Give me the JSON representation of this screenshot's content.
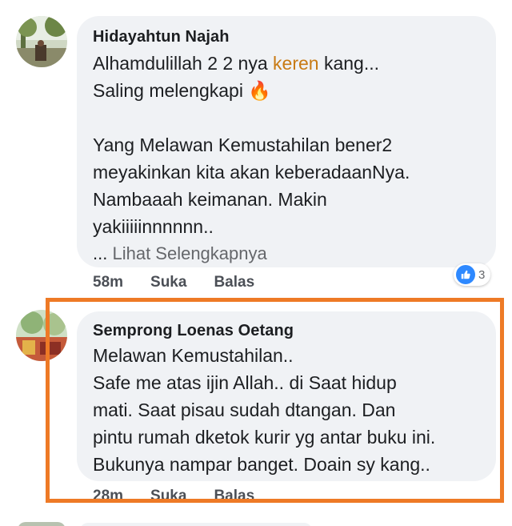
{
  "comments": [
    {
      "author": "Hidayahtun Najah",
      "line1_before": "Alhamdulillah 2 2 nya ",
      "line1_highlight": "keren",
      "line1_after": " kang...",
      "line2": "Saling melengkapi",
      "line2_emoji": "🔥",
      "line3": "Yang Melawan Kemustahilan bener2",
      "line4": "meyakinkan kita akan keberadaanNya.",
      "line5": "Nambaaah keimanan. Makin",
      "line6": "yakiiiiinnnnnn..",
      "see_more_dots": "...",
      "see_more": "Lihat Selengkapnya",
      "time": "58m",
      "like": "Suka",
      "reply": "Balas",
      "reaction_count": "3",
      "reaction_icon": "thumbs-up-icon",
      "accent_color": "#c87a14"
    },
    {
      "author": "Semprong Loenas Oetang",
      "lines": [
        "Melawan Kemustahilan..",
        "Safe me atas ijin  Allah..  di Saat hidup",
        "mati.  Saat pisau sudah dtangan.  Dan",
        "pintu rumah dketok kurir yg antar buku ini.",
        "Bukunya nampar banget.  Doain sy kang.."
      ],
      "time": "28m",
      "like": "Suka",
      "reply": "Balas",
      "highlight_color": "#ee7a26"
    }
  ]
}
